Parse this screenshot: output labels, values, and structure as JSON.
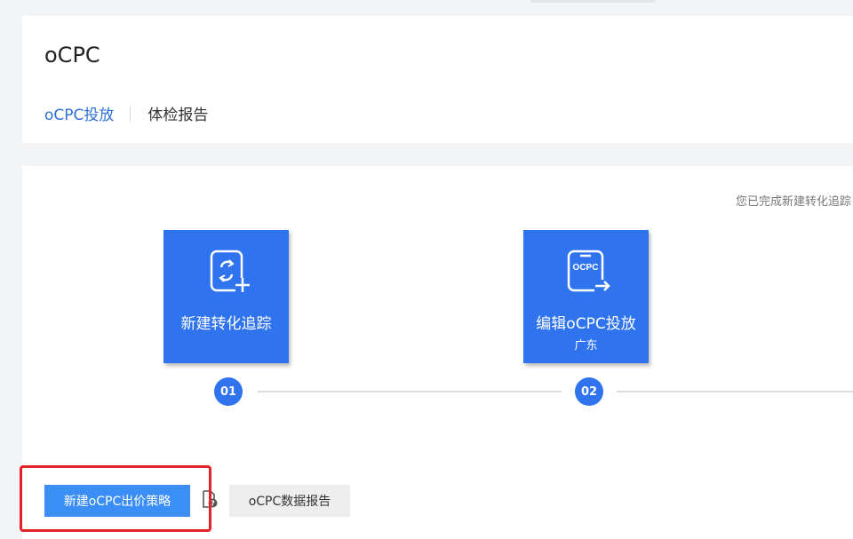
{
  "header": {
    "title": "oCPC",
    "tabs": [
      {
        "label": "oCPC投放",
        "active": true
      },
      {
        "label": "体检报告",
        "active": false
      }
    ]
  },
  "main": {
    "status_text": "您已完成新建转化追踪",
    "steps": [
      {
        "number": "01",
        "label": "新建转化追踪",
        "sublabel": "",
        "icon": "conversion-tracking-icon"
      },
      {
        "number": "02",
        "label": "编辑oCPC投放",
        "sublabel": "广东",
        "icon": "ocpc-document-icon",
        "icon_text": "OCPC"
      }
    ],
    "actions": {
      "primary_label": "新建oCPC出价策略",
      "secondary_label": "oCPC数据报告",
      "help_icon": "help-document-icon"
    }
  },
  "colors": {
    "accent": "#2f74ee",
    "primary_button": "#3a8ef5",
    "active_tab": "#2e6fd8",
    "highlight": "#e5232b"
  }
}
